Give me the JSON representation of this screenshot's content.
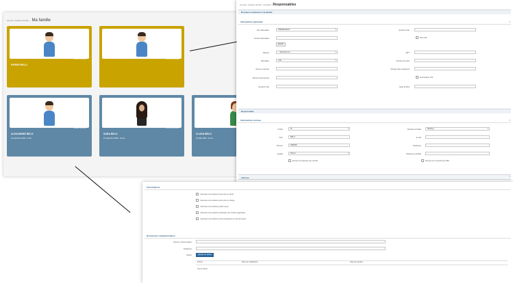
{
  "family": {
    "breadcrumb": [
      "Accueil",
      "Espace famille"
    ],
    "title": "Ma famille",
    "cards": [
      {
        "name": "PIERRE BELO",
        "caption": "Modifier la photo",
        "date": "",
        "avatar": "boy"
      },
      {
        "name": "",
        "caption": "Modifier la photo",
        "date": "",
        "avatar": "boy"
      },
      {
        "name": "ALEXANDRE BELO",
        "caption": "Modifier la photo",
        "date": "15 septembre 2012 - 6 ans",
        "avatar": "boy"
      },
      {
        "name": "SARA BELO",
        "caption": "Modifier la photo",
        "date": "15 septembre 2006 - 12 ans",
        "avatar": "photo"
      },
      {
        "name": "CLARA BELO",
        "caption": "Modifier la photo",
        "date": "15 juillet 2004 - 14 ans",
        "avatar": "girl"
      }
    ]
  },
  "responsable": {
    "breadcrumb": [
      "Accueil",
      "Espace famille",
      "Familles"
    ],
    "title": "Responsables",
    "sections": {
      "family_info": "Données communes à la famille",
      "general": "Informations générales",
      "responsable": "Responsable",
      "identity": "Informations de base",
      "address": "Adresse",
      "bank": "Informations bancaires"
    },
    "general_fields": {
      "nom_label": "Nom Allocataire",
      "nom_value": "PIERRE BELO",
      "quotient_label": "Quotient CAF",
      "numero_label": "Numéro Allocataire",
      "ajouter_label": "Ajouter",
      "autre_label": "Pas CAF",
      "regime_label": "Régime",
      "regime_value": "-- Sélectionnez --",
      "nb_label": "QPV",
      "allocataire_label": "Allocataire",
      "allocataire_value": "CAF",
      "nombre_part_label": "Nombre de parts",
      "revenu_label": "Revenu mensuel",
      "montant_label": "Montant des prestations",
      "revenu_fiscal_label": "Revenu fiscal annuel",
      "exoneration_label": "Exonération TVA",
      "quotient2_label": "Quotient CAF",
      "date_label": "Date de MAJ"
    },
    "identity_fields": {
      "civilite_label": "Civilité",
      "civilite_value": "M.",
      "situation_label": "Situation familiale",
      "situation_value": "Marié(e)",
      "nom_label": "Nom",
      "nom_value": "BELO",
      "email_label": "E-mail",
      "prenom_label": "Prénom",
      "prenom_value": "PIERRE",
      "telephone_label": "Téléphone",
      "qualite_label": "Qualité",
      "qualite_value": "Parent",
      "portable_label": "Téléphone portable",
      "check1": "Envoyer les factures par courriel",
      "check2": "Envoyer les courriels par SMS"
    }
  },
  "options": {
    "title": "Autorisations",
    "checks": [
      "J'autorise mes enfants à être pris en photo",
      "J'autorise mes enfants à être pris en charge",
      "J'autorise mes enfants à partir seuls",
      "J'autorise mes enfants à participer aux sorties organisées",
      "J'autorise mes enfants à être transportés en cas de besoin"
    ],
    "other_title": "Documents complémentaires",
    "other_fields": {
      "prenom_label": "Prénom / dénomination",
      "telephone_label": "Téléphone",
      "fichier_label": "Fichier",
      "browse_label": "Ajouter un fichier"
    },
    "table_headers": [
      "Fichier",
      "Date de modification",
      "Date de création"
    ],
    "empty_text": "Aucun fichier"
  }
}
